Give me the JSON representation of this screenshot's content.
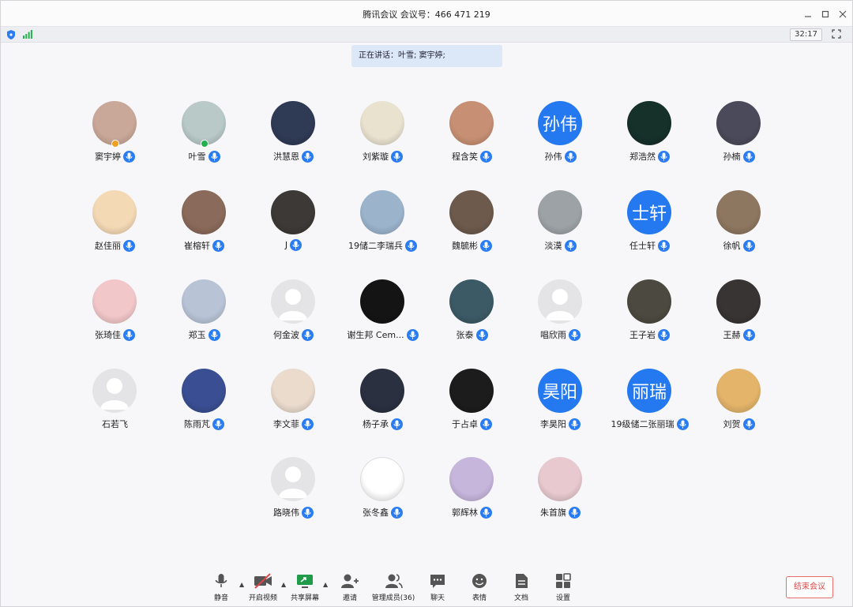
{
  "window": {
    "title": "腾讯会议  会议号：466 471 219"
  },
  "status": {
    "timer": "32:17"
  },
  "speaking": {
    "text": "正在讲话：叶雪; 窦宇婷;"
  },
  "members": [
    {
      "name": "窦宇婷",
      "avatar": "photo",
      "color": "#caa899",
      "badge": "#f0a020",
      "mic": "#2a7cf2"
    },
    {
      "name": "叶雪",
      "avatar": "photo",
      "color": "#b8c9c8",
      "badge": "#22b14c",
      "mic": "#2a7cf2"
    },
    {
      "name": "洪慧恩",
      "avatar": "photo",
      "color": "#2f3a55"
    },
    {
      "name": "刘紫璇",
      "avatar": "photo",
      "color": "#e9e2cf"
    },
    {
      "name": "程含笑",
      "avatar": "photo",
      "color": "#c79074"
    },
    {
      "name": "孙伟",
      "avatar": "text",
      "avatar_text": "孙伟"
    },
    {
      "name": "郑浩然",
      "avatar": "photo",
      "color": "#16302a"
    },
    {
      "name": "孙楠",
      "avatar": "photo",
      "color": "#4a4a5a"
    },
    {
      "name": "赵佳丽",
      "avatar": "photo",
      "color": "#f4d9b5"
    },
    {
      "name": "崔榕轩",
      "avatar": "photo",
      "color": "#8a6a5a"
    },
    {
      "name": "J",
      "avatar": "photo",
      "color": "#3d3936"
    },
    {
      "name": "19储二李瑞兵",
      "avatar": "photo",
      "color": "#9bb4cc"
    },
    {
      "name": "魏毓彬",
      "avatar": "photo",
      "color": "#6d5a4c"
    },
    {
      "name": "淡漠",
      "avatar": "photo",
      "color": "#9da2a6"
    },
    {
      "name": "任士轩",
      "avatar": "text",
      "avatar_text": "士轩"
    },
    {
      "name": "徐帆",
      "avatar": "photo",
      "color": "#8e7760"
    },
    {
      "name": "张琦佳",
      "avatar": "photo",
      "color": "#f2c7c9"
    },
    {
      "name": "郑玉",
      "avatar": "photo",
      "color": "#b8c4d6"
    },
    {
      "name": "何金波",
      "avatar": "silhouette"
    },
    {
      "name": "谢生邦       Cem...",
      "avatar": "photo",
      "color": "#141414"
    },
    {
      "name": "张泰",
      "avatar": "photo",
      "color": "#3c5a66"
    },
    {
      "name": "唱欣雨",
      "avatar": "silhouette"
    },
    {
      "name": "王子岩",
      "avatar": "photo",
      "color": "#4c4a40"
    },
    {
      "name": "王赫",
      "avatar": "photo",
      "color": "#383434"
    },
    {
      "name": "石若飞",
      "avatar": "silhouette",
      "mic": ""
    },
    {
      "name": "陈雨芃",
      "avatar": "photo",
      "color": "#3a4f93"
    },
    {
      "name": "李文菲",
      "avatar": "photo",
      "color": "#eadbcd"
    },
    {
      "name": "杨子承",
      "avatar": "photo",
      "color": "#2a3040"
    },
    {
      "name": "于占卓",
      "avatar": "photo",
      "color": "#1c1c1c"
    },
    {
      "name": "李昊阳",
      "avatar": "text",
      "avatar_text": "昊阳"
    },
    {
      "name": "19级储二张丽瑞",
      "avatar": "text",
      "avatar_text": "丽瑞"
    },
    {
      "name": "刘贺",
      "avatar": "photo",
      "color": "#e3b46a"
    },
    {
      "name": "路晓伟",
      "avatar": "silhouette"
    },
    {
      "name": "张冬鑫",
      "avatar": "photo",
      "color": "#ffffff"
    },
    {
      "name": "郭辉林",
      "avatar": "photo",
      "color": "#c7b6dc"
    },
    {
      "name": "朱首旗",
      "avatar": "photo",
      "color": "#e7c9cf"
    }
  ],
  "toolbar": {
    "mute": "静音",
    "video": "开启视频",
    "share": "共享屏幕",
    "invite": "邀请",
    "members": "管理成员(36)",
    "chat": "聊天",
    "reaction": "表情",
    "docs": "文档",
    "settings": "设置"
  },
  "end_button": "结束会议",
  "colors": {
    "accent": "#2a7cf2",
    "danger": "#e14545"
  }
}
